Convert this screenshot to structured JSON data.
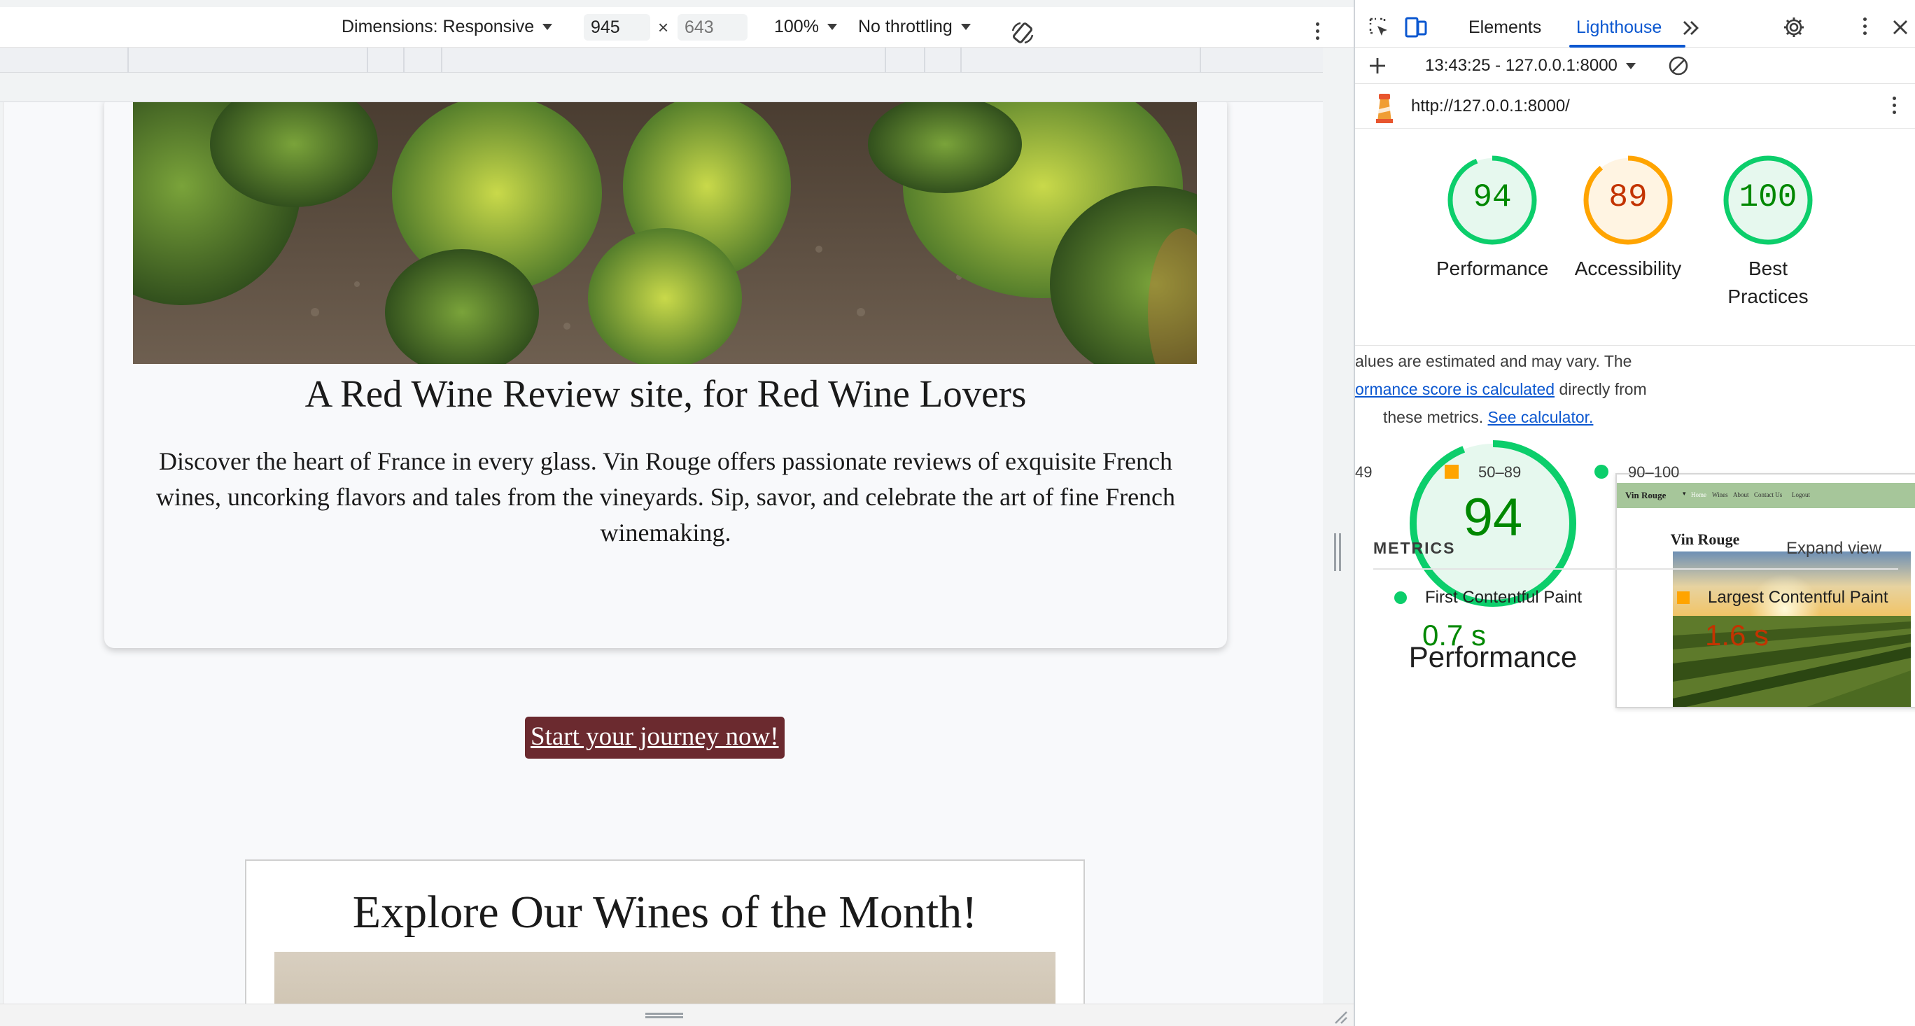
{
  "device_toolbar": {
    "dimensions_label": "Dimensions: Responsive",
    "width_value": "945",
    "height_placeholder": "643",
    "times": "×",
    "zoom": "100%",
    "throttling": "No throttling"
  },
  "page": {
    "hero_title": "A Red Wine Review site, for Red Wine Lovers",
    "hero_text": "Discover the heart of France in every glass. Vin Rouge offers passionate reviews of exquisite French wines, uncorking flavors and tales from the vineyards. Sip, savor, and celebrate the art of fine French winemaking.",
    "cta_label": "Start your journey now!",
    "wines_title": "Explore Our Wines of the Month!"
  },
  "devtools": {
    "tabs": [
      "Elements",
      "Lighthouse"
    ],
    "report_label": "13:43:25 - 127.0.0.1:8000",
    "url": "http://127.0.0.1:8000/",
    "scores": [
      {
        "label": "Performance",
        "value": 94,
        "status": "pass"
      },
      {
        "label": "Accessibility",
        "value": 89,
        "status": "average"
      },
      {
        "label": "Best Practices",
        "value": 100,
        "status": "pass"
      }
    ],
    "detail": {
      "score": 94,
      "title": "Performance",
      "note_line1": "alues are estimated and may vary. The",
      "note_link1": "ormance score is calculated",
      "note_line2_rest": " directly from",
      "note_line3": "these metrics.",
      "note_link2": "See calculator."
    },
    "thumbnail": {
      "brand": "Vin Rouge",
      "nav_items": [
        "Home",
        "Wines",
        "About",
        "Contact Us",
        "Logout"
      ],
      "title": "Vin Rouge"
    },
    "legend": [
      {
        "label": "49"
      },
      {
        "label": "50–89"
      },
      {
        "label": "90–100"
      }
    ],
    "metrics_header": "METRICS",
    "expand_view": "Expand view",
    "metrics": [
      {
        "name": "First Contentful Paint",
        "value": "0.7 s",
        "status": "pass"
      },
      {
        "name": "Largest Contentful Paint",
        "value": "1.6 s",
        "status": "average"
      }
    ],
    "colors": {
      "pass": "#0cce6b",
      "pass_text": "#008800",
      "average": "#ffa400",
      "average_text": "#c33300",
      "tab_active": "#0b57d0"
    }
  }
}
